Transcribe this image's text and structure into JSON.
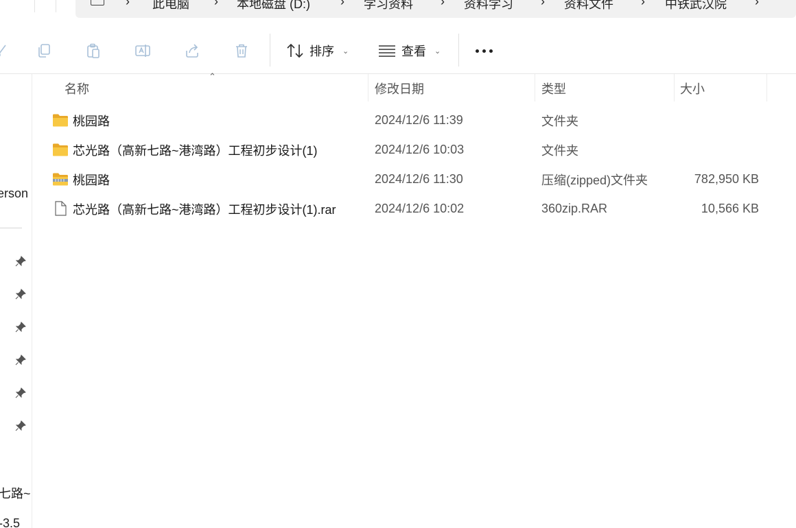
{
  "breadcrumb": {
    "items": [
      "此电脑",
      "本地磁盘 (D:)",
      "学习资料",
      "资料学习",
      "资料文件",
      "中铁武汉院"
    ]
  },
  "toolbar": {
    "sort_label": "排序",
    "view_label": "查看"
  },
  "nav": {
    "partial_items": [
      "erson",
      "七路~",
      "-3.5"
    ]
  },
  "columns": {
    "name": "名称",
    "date": "修改日期",
    "type": "类型",
    "size": "大小"
  },
  "files": [
    {
      "name": "桃园路",
      "date": "2024/12/6 11:39",
      "type": "文件夹",
      "size": "",
      "icon": "folder-icon"
    },
    {
      "name": "芯光路（高新七路~港湾路）工程初步设计(1)",
      "date": "2024/12/6 10:03",
      "type": "文件夹",
      "size": "",
      "icon": "folder-icon"
    },
    {
      "name": "桃园路",
      "date": "2024/12/6 11:30",
      "type": "压缩(zipped)文件夹",
      "size": "782,950 KB",
      "icon": "zip-folder-icon"
    },
    {
      "name": "芯光路（高新七路~港湾路）工程初步设计(1).rar",
      "date": "2024/12/6 10:02",
      "type": "360zip.RAR",
      "size": "10,566 KB",
      "icon": "file-icon"
    }
  ],
  "colors": {
    "folder": "#f8c843",
    "folder_dark": "#e9a92a",
    "icon_disabled": "#a8c0d8"
  }
}
